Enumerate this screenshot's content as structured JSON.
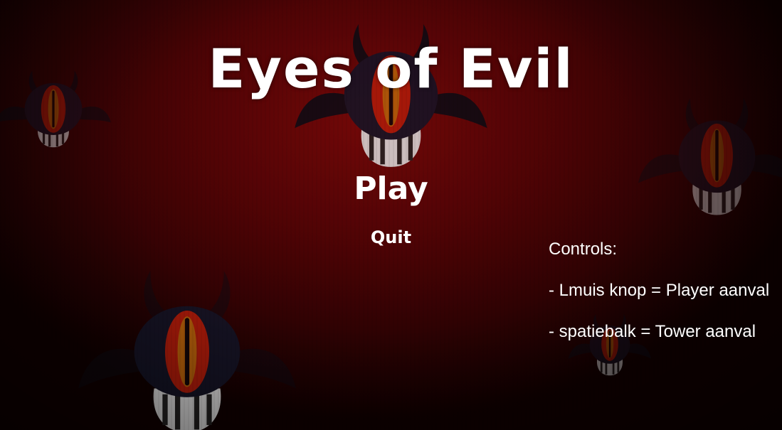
{
  "game": {
    "title": "Eyes of Evil"
  },
  "menu": {
    "play_label": "Play",
    "quit_label": "Quit"
  },
  "controls": {
    "heading": "Controls:",
    "lines": [
      "- Lmuis knop = Player aanval",
      "- spatiebalk = Tower aanval"
    ]
  },
  "colors": {
    "background_red": "#7a0808",
    "eye_body": "#141426",
    "iris_outer": "#b01c0a",
    "iris_inner": "#b8620a",
    "pupil": "#120608",
    "text": "#ffffff"
  }
}
